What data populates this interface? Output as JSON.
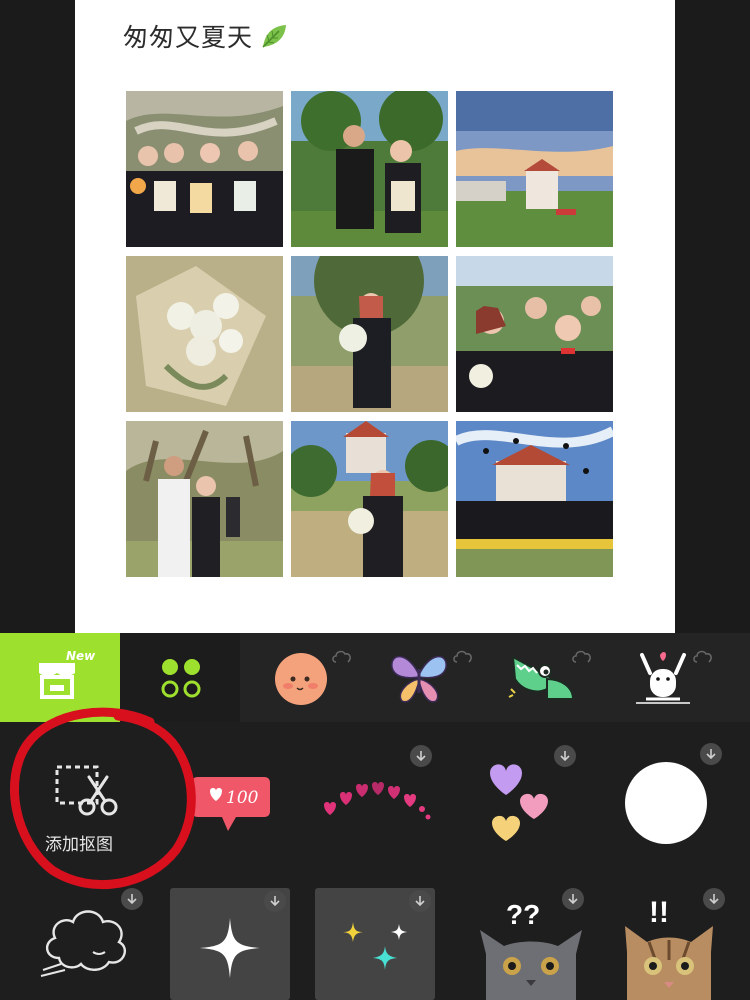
{
  "canvas": {
    "title": "匆匆又夏天"
  },
  "tabs": {
    "cutout": {
      "new_badge": "New"
    },
    "colors": {
      "accent": "#9ee02e",
      "selected_bg": "#1c1c1c"
    }
  },
  "panel": {
    "add_cutout_label": "添加抠图",
    "like_sticker_text": "100"
  },
  "stickers": [
    "peach-face-sticker",
    "butterfly-sticker",
    "crocodile-sticker",
    "cheering-bear-sticker",
    "like-100-sticker",
    "hearts-arc-sticker",
    "hearts-cluster-sticker",
    "white-circle-sticker",
    "steam-cloud-sticker",
    "single-sparkle-sticker",
    "multi-sparkle-sticker",
    "question-cat-sticker",
    "exclaim-cat-sticker"
  ]
}
